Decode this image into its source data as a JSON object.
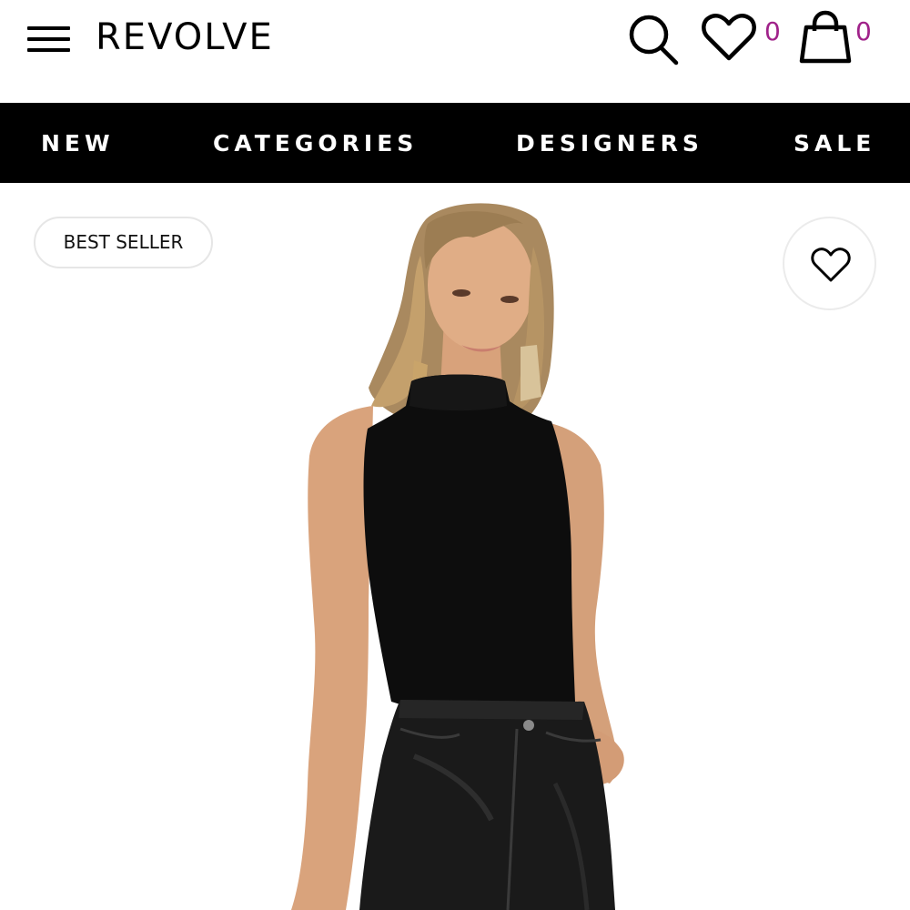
{
  "header": {
    "logo": "REVOLVE",
    "wishlist_count": "0",
    "bag_count": "0",
    "icons": [
      "menu-icon",
      "search-icon",
      "heart-icon",
      "bag-icon"
    ]
  },
  "nav": {
    "items": [
      {
        "label": "NEW"
      },
      {
        "label": "CATEGORIES"
      },
      {
        "label": "DESIGNERS"
      },
      {
        "label": "SALE"
      }
    ]
  },
  "product": {
    "badge": "BEST SELLER",
    "favorite_icon": "heart-outline-icon"
  },
  "colors": {
    "nav_background": "#000000",
    "count_accent": "#a0228a"
  }
}
